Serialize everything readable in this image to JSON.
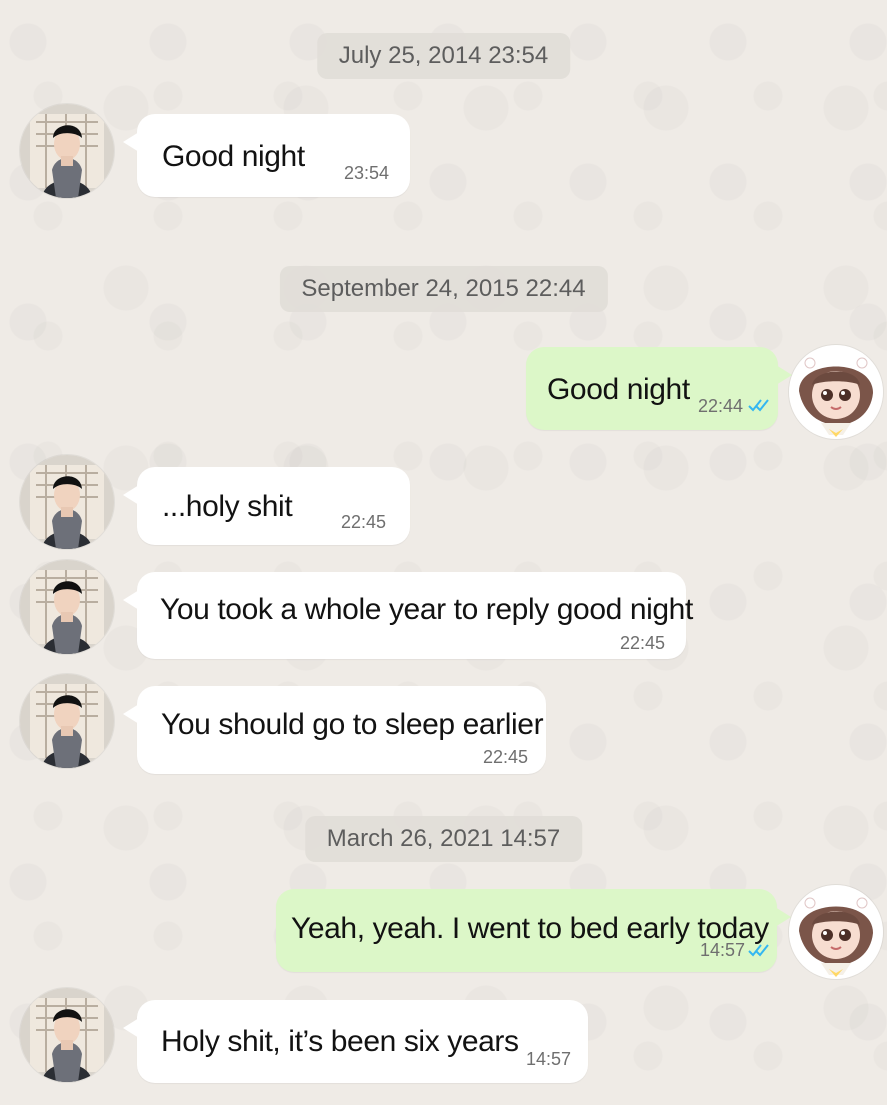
{
  "dates": [
    "July 25, 2014  23:54",
    "September 24, 2015  22:44",
    "March 26, 2021  14:57"
  ],
  "messages": [
    {
      "text": "Good night",
      "time": "23:54",
      "sender": "male",
      "read": false
    },
    {
      "text": "Good night",
      "time": "22:44",
      "sender": "female",
      "read": true
    },
    {
      "text": "...holy shit",
      "time": "22:45",
      "sender": "male",
      "read": false
    },
    {
      "text": "You took a whole year to reply good night",
      "time": "22:45",
      "sender": "male",
      "read": false
    },
    {
      "text": "You should go to sleep earlier",
      "time": "22:45",
      "sender": "male",
      "read": false
    },
    {
      "text": "Yeah, yeah. I went to bed early today",
      "time": "14:57",
      "sender": "female",
      "read": true
    },
    {
      "text": "Holy shit, it’s been six years",
      "time": "14:57",
      "sender": "male",
      "read": false
    }
  ],
  "colors": {
    "background": "#efebe6",
    "incoming_bubble": "#ffffff",
    "outgoing_bubble": "#dcf7c8",
    "date_chip": "#e1ddd8",
    "read_tick": "#34b7f1"
  },
  "icons": {
    "male_avatar": "male-avatar-icon",
    "female_avatar": "female-avatar-icon",
    "read_receipt": "double-check-icon"
  }
}
